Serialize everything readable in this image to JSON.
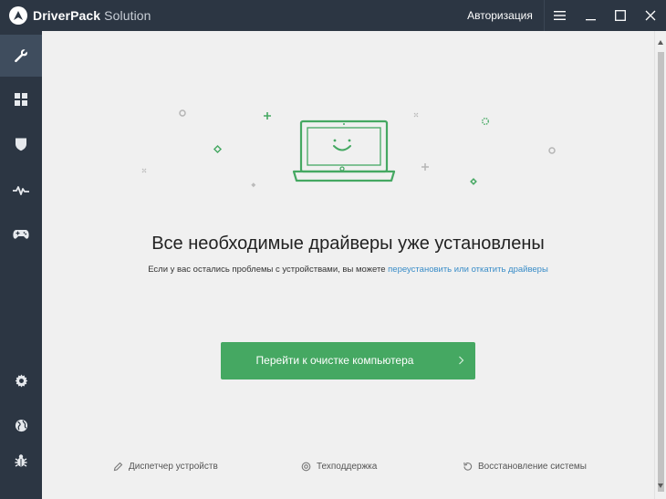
{
  "titlebar": {
    "app_name": "DriverPack",
    "app_name_suffix": " Solution",
    "auth_label": "Авторизация"
  },
  "sidebar": {
    "items": [
      {
        "icon": "wrench-icon",
        "active": true
      },
      {
        "icon": "grid-icon",
        "active": false
      },
      {
        "icon": "shield-icon",
        "active": false
      },
      {
        "icon": "pulse-icon",
        "active": false
      },
      {
        "icon": "gamepad-icon",
        "active": false
      },
      {
        "icon": "gear-icon",
        "active": false
      },
      {
        "icon": "globe-icon",
        "active": false
      },
      {
        "icon": "bug-icon",
        "active": false
      }
    ]
  },
  "main": {
    "headline": "Все необходимые драйверы уже установлены",
    "subline_text": "Если у вас остались проблемы с устройствами, вы можете ",
    "subline_link": "переустановить или откатить драйверы",
    "cta_label": "Перейти к очистке компьютера",
    "footer": {
      "device_manager": "Диспетчер устройств",
      "support": "Техподдержка",
      "restore": "Восстановление системы"
    }
  },
  "colors": {
    "sidebar_bg": "#2c3643",
    "sidebar_active": "#3f4d5e",
    "accent_green": "#45a862",
    "link_blue": "#3a8dc8",
    "content_bg": "#f0f0f0"
  }
}
